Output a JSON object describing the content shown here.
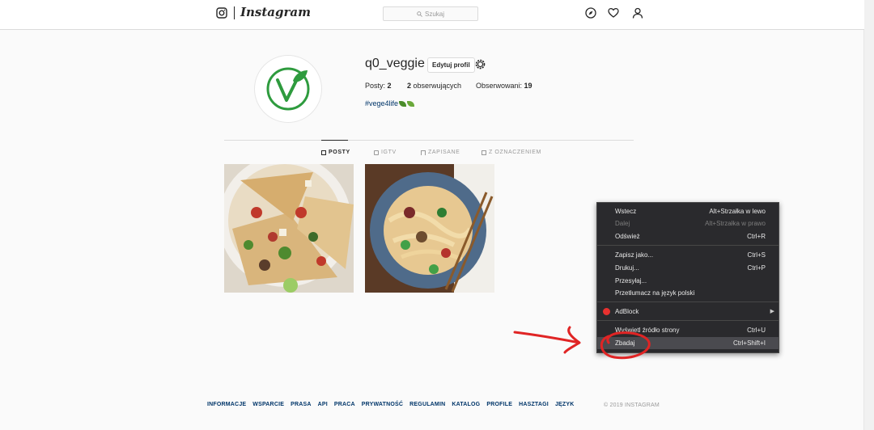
{
  "header": {
    "brand": "Instagram",
    "search_placeholder": "Szukaj"
  },
  "profile": {
    "username": "q0_veggie",
    "edit_label": "Edytuj profil",
    "posts_label": "Posty:",
    "posts_count": "2",
    "followers_count": "2",
    "followers_label": "obserwujących",
    "following_label": "Obserwowani:",
    "following_count": "19",
    "bio": "#vege4life"
  },
  "tabs": [
    {
      "label": "POSTY",
      "active": true
    },
    {
      "label": "IGTV",
      "active": false
    },
    {
      "label": "ZAPISANE",
      "active": false
    },
    {
      "label": "Z OZNACZENIEM",
      "active": false
    }
  ],
  "context_menu": {
    "items": [
      {
        "label": "Wstecz",
        "shortcut": "Alt+Strzałka w lewo",
        "disabled": false
      },
      {
        "label": "Dalej",
        "shortcut": "Alt+Strzałka w prawo",
        "disabled": true
      },
      {
        "label": "Odśwież",
        "shortcut": "Ctrl+R",
        "disabled": false
      },
      {
        "label": "Zapisz jako...",
        "shortcut": "Ctrl+S",
        "disabled": false
      },
      {
        "label": "Drukuj...",
        "shortcut": "Ctrl+P",
        "disabled": false
      },
      {
        "label": "Przesyłaj...",
        "shortcut": "",
        "disabled": false
      },
      {
        "label": "Przetłumacz na język polski",
        "shortcut": "",
        "disabled": false
      },
      {
        "label": "AdBlock",
        "shortcut": "",
        "disabled": false
      },
      {
        "label": "Wyświetl źródło strony",
        "shortcut": "Ctrl+U",
        "disabled": false
      },
      {
        "label": "Zbadaj",
        "shortcut": "Ctrl+Shift+I",
        "disabled": false
      }
    ]
  },
  "footer": {
    "links": [
      "INFORMACJE",
      "WSPARCIE",
      "PRASA",
      "API",
      "PRACA",
      "PRYWATNOŚĆ",
      "REGULAMIN",
      "KATALOG",
      "PROFILE",
      "HASZTAGI",
      "JĘZYK"
    ],
    "copyright": "© 2019 INSTAGRAM"
  },
  "colors": {
    "accent_link": "#003569",
    "menu_bg": "#2a2a2d",
    "annotation_red": "#e02424",
    "vegan_green": "#2e9b3e"
  },
  "icons": [
    "instagram-camera-icon",
    "search-icon",
    "compass-icon",
    "heart-icon",
    "user-icon",
    "settings-gear-icon",
    "grid-icon",
    "igtv-icon",
    "bookmark-icon",
    "tag-icon",
    "adblock-icon",
    "submenu-arrow-icon"
  ]
}
